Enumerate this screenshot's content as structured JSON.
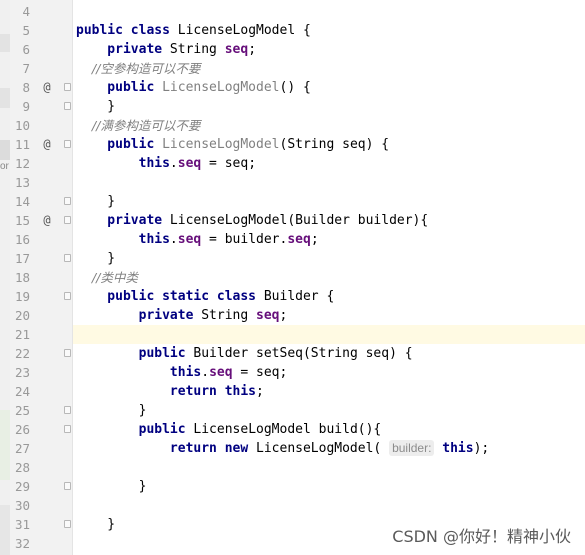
{
  "colors": {
    "keyword": "#000080",
    "field": "#660e7a",
    "comment": "#808080",
    "gutter_bg": "#f2f2f2",
    "current_line_bg": "#fffae3"
  },
  "left_edge_fragment": "or",
  "lines": [
    {
      "n": "4",
      "tokens": []
    },
    {
      "n": "5",
      "tokens": [
        [
          "kw",
          "public class "
        ],
        [
          "t",
          "LicenseLogModel {"
        ]
      ]
    },
    {
      "n": "6",
      "tokens": [
        [
          "kw",
          "    private "
        ],
        [
          "t",
          "String "
        ],
        [
          "fld",
          "seq"
        ],
        [
          "t",
          ";"
        ]
      ]
    },
    {
      "n": "7",
      "tokens": [
        [
          "cm",
          "    //空参构造可以不要"
        ]
      ]
    },
    {
      "n": "8",
      "ann": "@",
      "fold": true,
      "tokens": [
        [
          "kw",
          "    public "
        ],
        [
          "unused",
          "LicenseLogModel"
        ],
        [
          "t",
          "() {"
        ]
      ]
    },
    {
      "n": "9",
      "fold": true,
      "tokens": [
        [
          "t",
          "    }"
        ]
      ]
    },
    {
      "n": "10",
      "tokens": [
        [
          "cm",
          "    //满参构造可以不要"
        ]
      ]
    },
    {
      "n": "11",
      "ann": "@",
      "fold": true,
      "tokens": [
        [
          "kw",
          "    public "
        ],
        [
          "unused",
          "LicenseLogModel"
        ],
        [
          "t",
          "(String seq) {"
        ]
      ]
    },
    {
      "n": "12",
      "tokens": [
        [
          "kw",
          "        this"
        ],
        [
          "t",
          "."
        ],
        [
          "fld",
          "seq"
        ],
        [
          "t",
          " = seq;"
        ]
      ]
    },
    {
      "n": "13",
      "tokens": []
    },
    {
      "n": "14",
      "fold": true,
      "tokens": [
        [
          "t",
          "    }"
        ]
      ]
    },
    {
      "n": "15",
      "ann": "@",
      "fold": true,
      "tokens": [
        [
          "kw",
          "    private "
        ],
        [
          "t",
          "LicenseLogModel(Builder builder){"
        ]
      ]
    },
    {
      "n": "16",
      "tokens": [
        [
          "kw",
          "        this"
        ],
        [
          "t",
          "."
        ],
        [
          "fld",
          "seq"
        ],
        [
          "t",
          " = builder."
        ],
        [
          "fld",
          "seq"
        ],
        [
          "t",
          ";"
        ]
      ]
    },
    {
      "n": "17",
      "fold": true,
      "tokens": [
        [
          "t",
          "    }"
        ]
      ]
    },
    {
      "n": "18",
      "tokens": [
        [
          "cm",
          "    //类中类"
        ]
      ]
    },
    {
      "n": "19",
      "fold": true,
      "tokens": [
        [
          "kw",
          "    public static class "
        ],
        [
          "t",
          "Builder {"
        ]
      ]
    },
    {
      "n": "20",
      "tokens": [
        [
          "kw",
          "        private "
        ],
        [
          "t",
          "String "
        ],
        [
          "fld",
          "seq"
        ],
        [
          "t",
          ";"
        ]
      ]
    },
    {
      "n": "21",
      "current": true,
      "tokens": []
    },
    {
      "n": "22",
      "fold": true,
      "tokens": [
        [
          "kw",
          "        public "
        ],
        [
          "t",
          "Builder setSeq(String seq) {"
        ]
      ]
    },
    {
      "n": "23",
      "tokens": [
        [
          "kw",
          "            this"
        ],
        [
          "t",
          "."
        ],
        [
          "fld",
          "seq"
        ],
        [
          "t",
          " = seq;"
        ]
      ]
    },
    {
      "n": "24",
      "tokens": [
        [
          "kw",
          "            return this"
        ],
        [
          "t",
          ";"
        ]
      ]
    },
    {
      "n": "25",
      "fold": true,
      "tokens": [
        [
          "t",
          "        }"
        ]
      ]
    },
    {
      "n": "26",
      "fold": true,
      "tokens": [
        [
          "kw",
          "        public "
        ],
        [
          "t",
          "LicenseLogModel build(){"
        ]
      ]
    },
    {
      "n": "27",
      "tokens": [
        [
          "kw",
          "            return new "
        ],
        [
          "t",
          "LicenseLogModel( "
        ],
        [
          "hint",
          "builder:"
        ],
        [
          "kw",
          " this"
        ],
        [
          "t",
          ");"
        ]
      ]
    },
    {
      "n": "28",
      "tokens": []
    },
    {
      "n": "29",
      "fold": true,
      "tokens": [
        [
          "t",
          "        }"
        ]
      ]
    },
    {
      "n": "30",
      "tokens": []
    },
    {
      "n": "31",
      "fold": true,
      "tokens": [
        [
          "t",
          "    }"
        ]
      ]
    },
    {
      "n": "32",
      "tokens": []
    }
  ],
  "watermark": "CSDN @你好！精神小伙"
}
